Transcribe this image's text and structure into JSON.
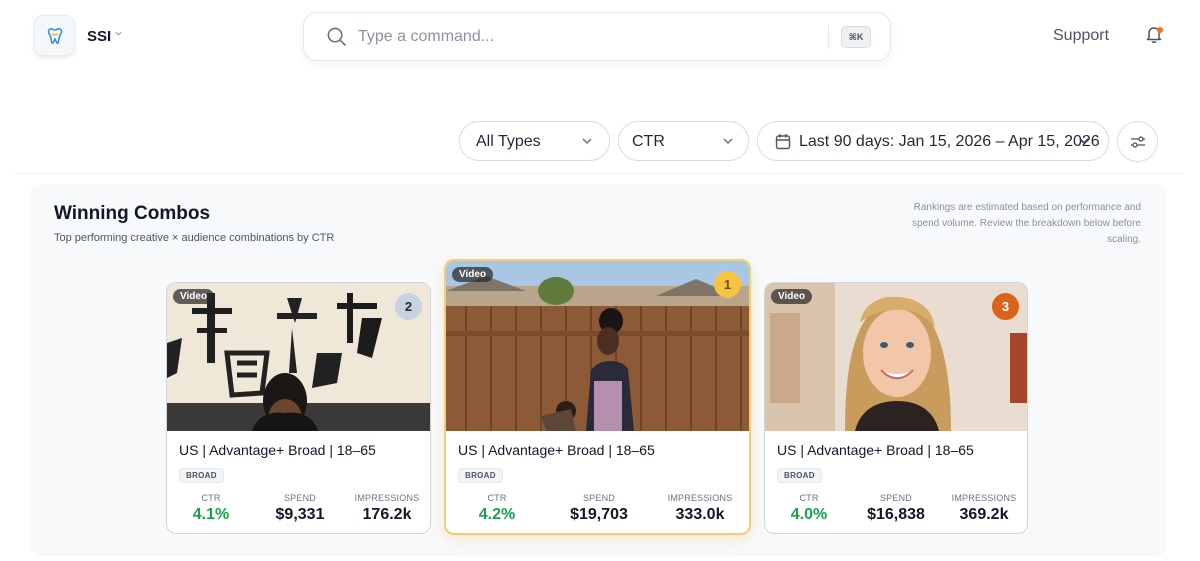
{
  "header": {
    "org_name": "SSI",
    "search_placeholder": "Type a command...",
    "shortcut": "⌘K",
    "support_label": "Support"
  },
  "filters": {
    "type": "All Types",
    "metric": "CTR",
    "date_range": "Last 90 days: Jan 15, 2026 – Apr 15, 2026"
  },
  "panel": {
    "title": "Winning Combos",
    "subtitle": "Top performing creative × audience combinations by CTR",
    "note": "Rankings are estimated based on performance and spend volume. Review the breakdown below before scaling."
  },
  "cards": [
    {
      "rank": "2",
      "badge": "Video",
      "title": "US | Advantage+ Broad | 18–65",
      "tag": "BROAD",
      "ctr_label": "CTR",
      "ctr": "4.1%",
      "spend_label": "SPEND",
      "spend": "$9,331",
      "impressions_label": "IMPRESSIONS",
      "impressions": "176.2k"
    },
    {
      "rank": "1",
      "badge": "Video",
      "title": "US | Advantage+ Broad | 18–65",
      "tag": "BROAD",
      "ctr_label": "CTR",
      "ctr": "4.2%",
      "spend_label": "SPEND",
      "spend": "$19,703",
      "impressions_label": "IMPRESSIONS",
      "impressions": "333.0k"
    },
    {
      "rank": "3",
      "badge": "Video",
      "title": "US | Advantage+ Broad | 18–65",
      "tag": "BROAD",
      "ctr_label": "CTR",
      "ctr": "4.0%",
      "spend_label": "SPEND",
      "spend": "$16,838",
      "impressions_label": "IMPRESSIONS",
      "impressions": "369.2k"
    }
  ],
  "colors": {
    "rank_1": "#f6c343",
    "rank_2": "#c9d3e0",
    "rank_3": "#d9631a",
    "ctr_green": "#16a34a",
    "featured_border": "#f2cd73"
  },
  "icons": {
    "logo": "tooth-logo-icon",
    "search": "search-icon",
    "bell": "bell-icon",
    "calendar": "calendar-icon",
    "chevron": "chevron-down-icon",
    "settings": "sliders-icon"
  }
}
